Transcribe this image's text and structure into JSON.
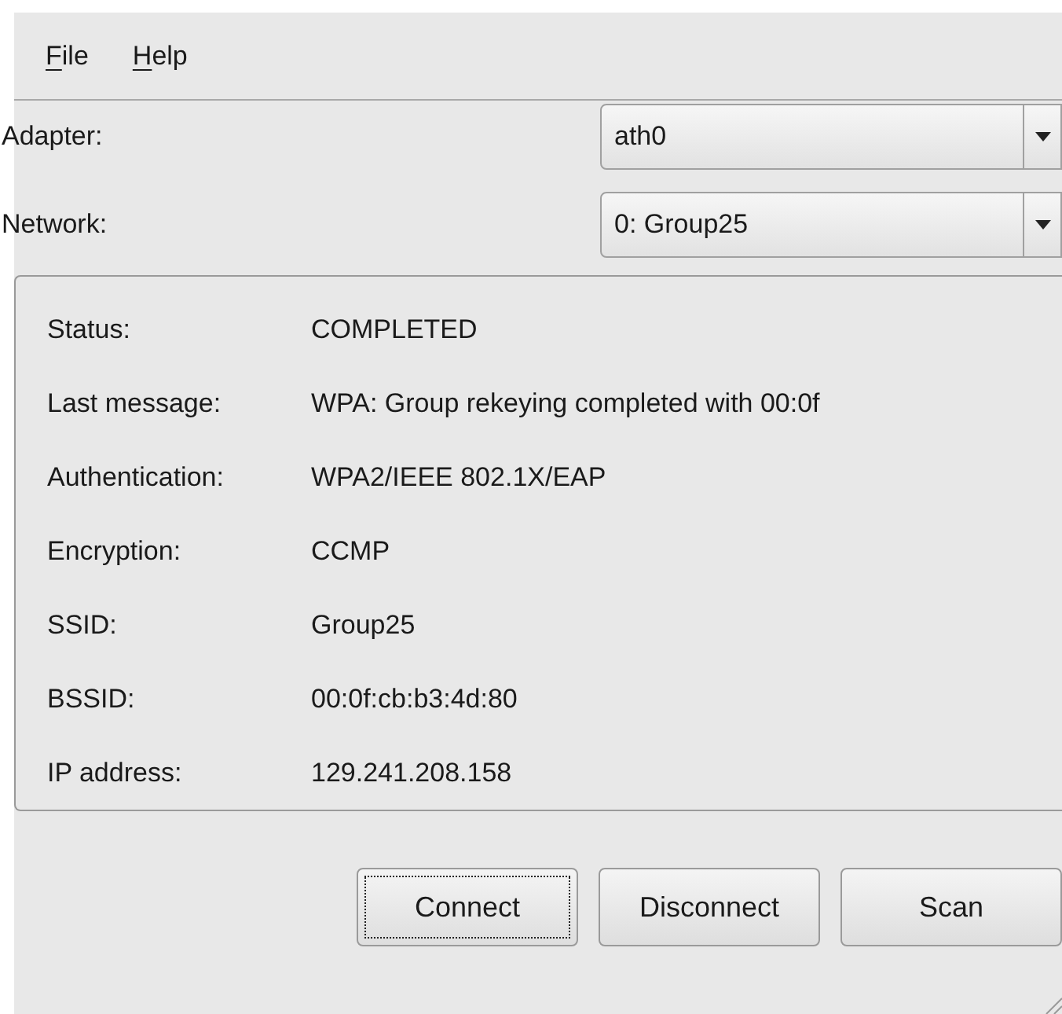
{
  "menu": [
    {
      "label": "File"
    },
    {
      "label": "Help"
    }
  ],
  "selectors": [
    {
      "label": "Adapter:",
      "value": "ath0"
    },
    {
      "label": "Network:",
      "value": "0: Group25"
    }
  ],
  "status": [
    {
      "label": "Status:",
      "value": "COMPLETED"
    },
    {
      "label": "Last message:",
      "value": "WPA: Group rekeying completed with 00:0f"
    },
    {
      "label": "Authentication:",
      "value": "WPA2/IEEE 802.1X/EAP"
    },
    {
      "label": "Encryption:",
      "value": "CCMP"
    },
    {
      "label": "SSID:",
      "value": "Group25"
    },
    {
      "label": "BSSID:",
      "value": "00:0f:cb:b3:4d:80"
    },
    {
      "label": "IP address:",
      "value": "129.241.208.158"
    }
  ],
  "buttons": [
    {
      "label": "Connect",
      "focused": true
    },
    {
      "label": "Disconnect",
      "focused": false
    },
    {
      "label": "Scan",
      "focused": false
    }
  ]
}
